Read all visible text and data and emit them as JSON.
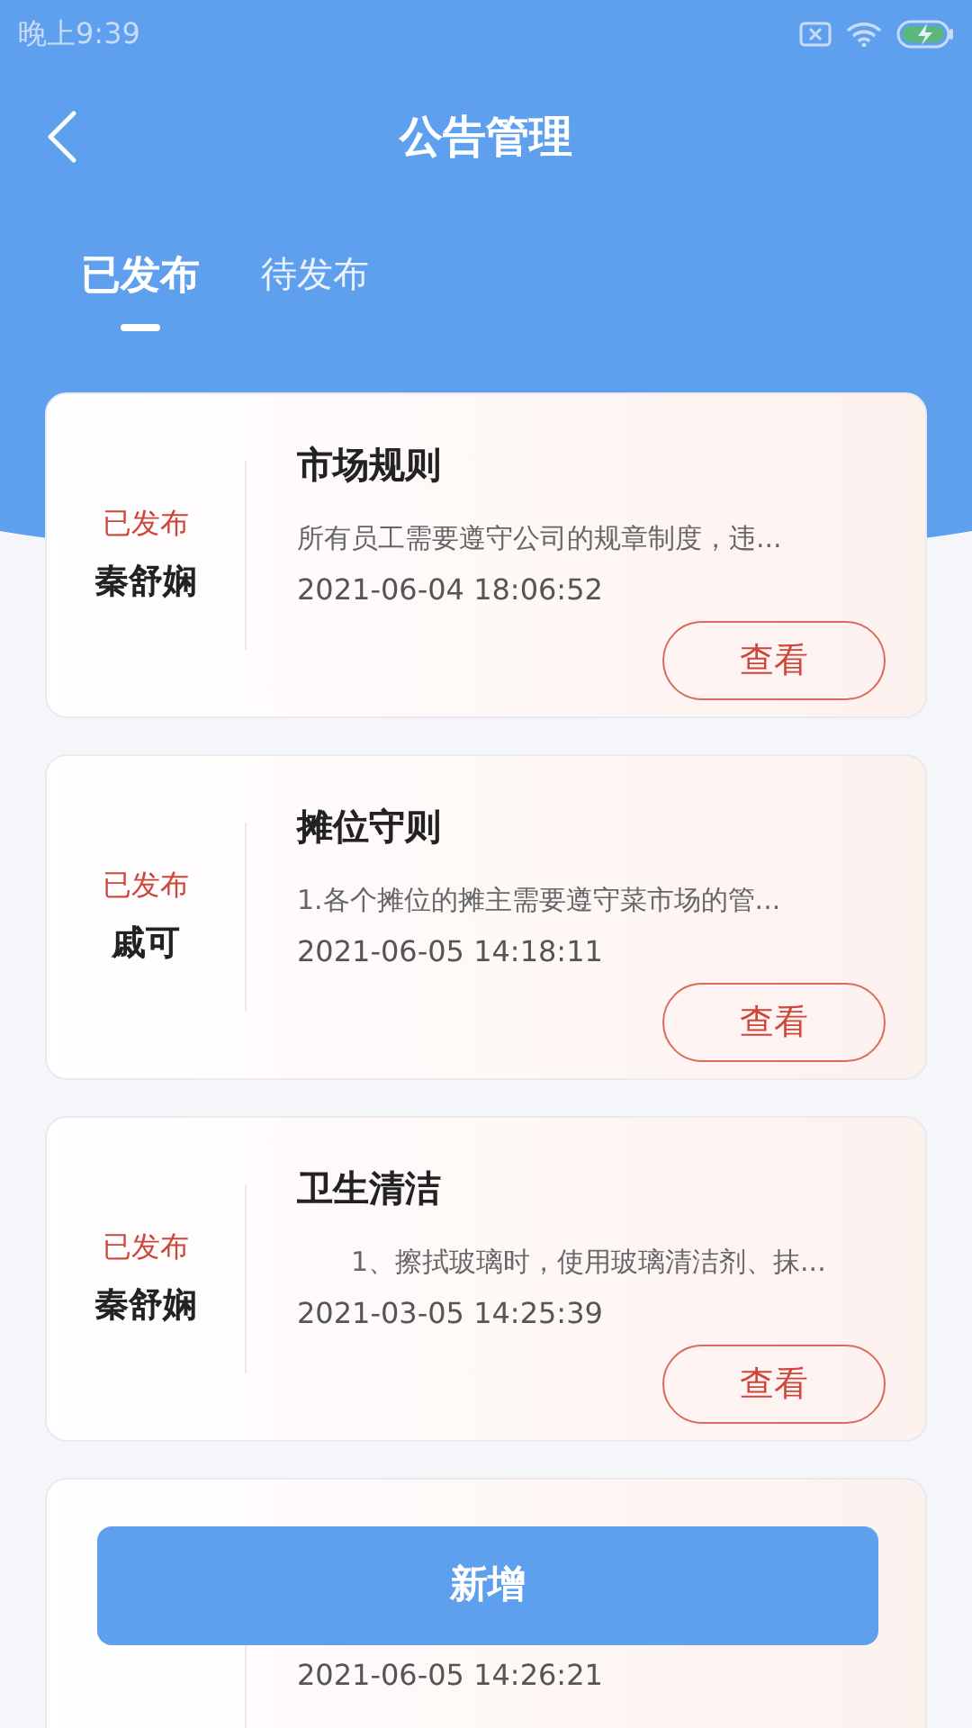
{
  "status_bar": {
    "time": "晚上9:39"
  },
  "header": {
    "title": "公告管理"
  },
  "tabs": [
    {
      "label": "已发布",
      "selected": true
    },
    {
      "label": "待发布",
      "selected": false
    }
  ],
  "notices": [
    {
      "status": "已发布",
      "author": "秦舒娴",
      "title": "市场规则",
      "summary": "所有员工需要遵守公司的规章制度，违...",
      "date": "2021-06-04 18:06:52",
      "button": "查看"
    },
    {
      "status": "已发布",
      "author": "戚可",
      "title": "摊位守则",
      "summary": "1.各个摊位的摊主需要遵守菜市场的管...",
      "date": "2021-06-05 14:18:11",
      "button": "查看"
    },
    {
      "status": "已发布",
      "author": "秦舒娴",
      "title": "卫生清洁",
      "summary": "　　1、擦拭玻璃时，使用玻璃清洁剂、抹...",
      "date": "2021-03-05 14:25:39",
      "button": "查看"
    },
    {
      "date": "2021-06-05 14:26:21"
    }
  ],
  "add_button": {
    "label": "新增"
  }
}
